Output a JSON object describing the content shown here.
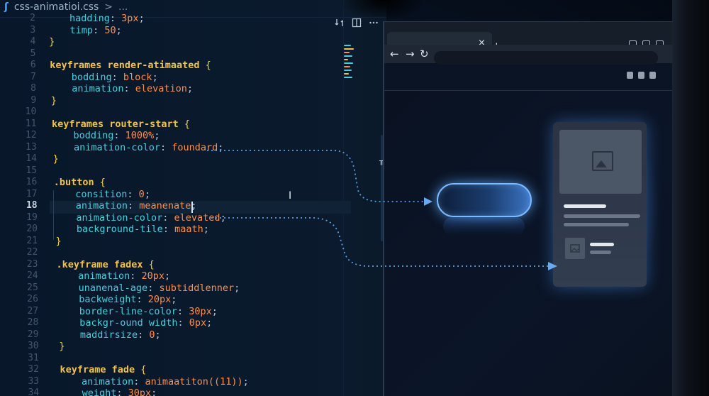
{
  "editor": {
    "file_tab": "css-animatioi.css",
    "breadcrumb_sep": ">",
    "breadcrumb_more": "...",
    "active_line": 18,
    "lines": [
      {
        "n": "2",
        "code": [
          [
            "k-prop",
            "hadding"
          ],
          [
            "k-punc",
            ": "
          ],
          [
            "k-val",
            "3px"
          ],
          [
            "k-punc",
            ";"
          ]
        ]
      },
      {
        "n": "3",
        "code": [
          [
            "k-prop",
            "timp"
          ],
          [
            "k-punc",
            ": "
          ],
          [
            "k-num",
            "50"
          ],
          [
            "k-punc",
            ";"
          ]
        ]
      },
      {
        "n": "4",
        "code": [
          [
            "k-brace",
            "}"
          ]
        ]
      },
      {
        "n": "5",
        "code": []
      },
      {
        "n": "6",
        "code": [
          [
            "k-kw",
            "keyframes render-atimaated "
          ],
          [
            "k-brace",
            "{"
          ]
        ]
      },
      {
        "n": "7",
        "code": [
          [
            "k-prop",
            "bodding"
          ],
          [
            "k-punc",
            ": "
          ],
          [
            "k-val",
            "block"
          ],
          [
            "k-punc",
            ";"
          ]
        ]
      },
      {
        "n": "8",
        "code": [
          [
            "k-prop",
            "animation"
          ],
          [
            "k-punc",
            ": "
          ],
          [
            "k-val",
            "elevation"
          ],
          [
            "k-punc",
            ";"
          ]
        ]
      },
      {
        "n": "9",
        "code": [
          [
            "k-brace",
            "}"
          ]
        ]
      },
      {
        "n": "10",
        "code": []
      },
      {
        "n": "11",
        "code": [
          [
            "k-kw",
            "keyframes router-start "
          ],
          [
            "k-brace",
            "{"
          ]
        ]
      },
      {
        "n": "12",
        "code": [
          [
            "k-prop",
            "bodding"
          ],
          [
            "k-punc",
            ": "
          ],
          [
            "k-num",
            "1000%"
          ],
          [
            "k-punc",
            ";"
          ]
        ]
      },
      {
        "n": "13",
        "code": [
          [
            "k-prop",
            "animation-color"
          ],
          [
            "k-punc",
            ": "
          ],
          [
            "k-val",
            "foundard"
          ],
          [
            "k-punc",
            ";"
          ]
        ]
      },
      {
        "n": "14",
        "code": [
          [
            "k-brace",
            "}"
          ]
        ]
      },
      {
        "n": "15",
        "code": []
      },
      {
        "n": "16",
        "code": [
          [
            "k-sel",
            ".button "
          ],
          [
            "k-brace",
            "{"
          ]
        ]
      },
      {
        "n": "17",
        "code": [
          [
            "k-prop",
            "consition"
          ],
          [
            "k-punc",
            ": "
          ],
          [
            "k-num",
            "0"
          ],
          [
            "k-punc",
            ";"
          ]
        ]
      },
      {
        "n": "18",
        "code": [
          [
            "k-prop",
            "animation"
          ],
          [
            "k-punc",
            ": "
          ],
          [
            "k-val",
            "meanenate"
          ],
          [
            "k-punc",
            ";"
          ]
        ]
      },
      {
        "n": "19",
        "code": [
          [
            "k-prop",
            "animation-color"
          ],
          [
            "k-punc",
            ": "
          ],
          [
            "k-val",
            "elevated"
          ],
          [
            "k-punc",
            ";"
          ]
        ]
      },
      {
        "n": "20",
        "code": [
          [
            "k-prop",
            "background-tile"
          ],
          [
            "k-punc",
            ": "
          ],
          [
            "k-val",
            "maath"
          ],
          [
            "k-punc",
            ";"
          ]
        ]
      },
      {
        "n": "21",
        "code": [
          [
            "k-brace",
            "}"
          ]
        ]
      },
      {
        "n": "22",
        "code": []
      },
      {
        "n": "23",
        "code": [
          [
            "k-sel",
            ".keyframe fadex "
          ],
          [
            "k-brace",
            "{"
          ]
        ]
      },
      {
        "n": "24",
        "code": [
          [
            "k-prop",
            "animation"
          ],
          [
            "k-punc",
            ": "
          ],
          [
            "k-num",
            "20px"
          ],
          [
            "k-punc",
            ";"
          ]
        ]
      },
      {
        "n": "25",
        "code": [
          [
            "k-prop",
            "unanenal-age"
          ],
          [
            "k-punc",
            ": "
          ],
          [
            "k-val",
            "subtiddlenner"
          ],
          [
            "k-punc",
            ";"
          ]
        ]
      },
      {
        "n": "26",
        "code": [
          [
            "k-prop",
            "backweight"
          ],
          [
            "k-punc",
            ": "
          ],
          [
            "k-num",
            "20px"
          ],
          [
            "k-punc",
            ";"
          ]
        ]
      },
      {
        "n": "27",
        "code": [
          [
            "k-prop",
            "border-line-color"
          ],
          [
            "k-punc",
            ": "
          ],
          [
            "k-num",
            "30px"
          ],
          [
            "k-punc",
            ";"
          ]
        ]
      },
      {
        "n": "28",
        "code": [
          [
            "k-prop",
            "backgr-ound width"
          ],
          [
            "k-punc",
            ": "
          ],
          [
            "k-num",
            "0px"
          ],
          [
            "k-punc",
            ";"
          ]
        ]
      },
      {
        "n": "29",
        "code": [
          [
            "k-prop",
            "maddirsize"
          ],
          [
            "k-punc",
            ": "
          ],
          [
            "k-num",
            "0"
          ],
          [
            "k-punc",
            ";"
          ]
        ]
      },
      {
        "n": "30",
        "code": [
          [
            "k-brace",
            "}"
          ]
        ]
      },
      {
        "n": "31",
        "code": []
      },
      {
        "n": "32",
        "code": [
          [
            "k-kw",
            "keyframe fade "
          ],
          [
            "k-brace",
            "{"
          ]
        ]
      },
      {
        "n": "33",
        "code": [
          [
            "k-prop",
            "animation"
          ],
          [
            "k-punc",
            ": "
          ],
          [
            "k-val",
            "animaatiton(("
          ],
          [
            "k-num",
            "11"
          ],
          [
            "k-val",
            "))"
          ],
          [
            "k-punc",
            ";"
          ]
        ]
      },
      {
        "n": "34",
        "code": [
          [
            "k-prop",
            "weight"
          ],
          [
            "k-punc",
            ": "
          ],
          [
            "k-num",
            "30px"
          ],
          [
            "k-punc",
            ";"
          ]
        ]
      }
    ]
  },
  "browser": {
    "tab_close": "×",
    "new_tab": "+",
    "nav_back": "←",
    "nav_forward": "→",
    "nav_reload": "↻"
  },
  "colors": {
    "accent_glow": "#7db9ff",
    "selector": "#f1c24a",
    "property": "#45d0df",
    "value": "#ff8f4a"
  }
}
